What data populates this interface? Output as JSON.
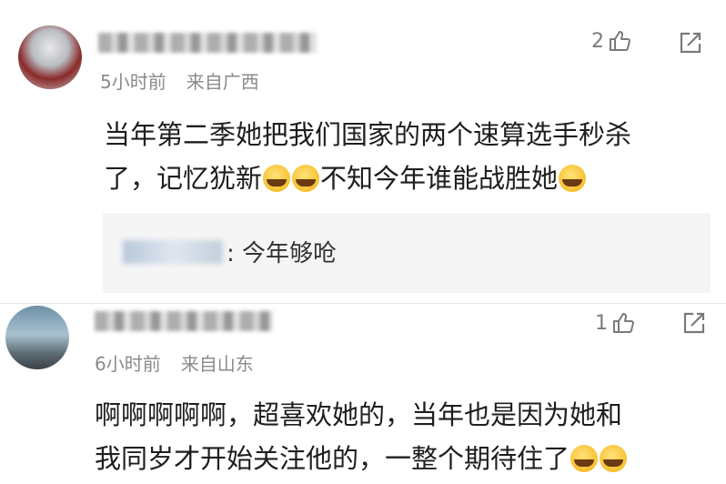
{
  "comments": [
    {
      "time": "5小时前",
      "location": "来自广西",
      "likes": "2",
      "text_line1": "当年第二季她把我们国家的两个速算选手秒杀",
      "text_line2_a": "了，记忆犹新",
      "text_line2_b": "不知今年谁能战胜她",
      "reply": {
        "text": ": 今年够呛"
      }
    },
    {
      "time": "6小时前",
      "location": "来自山东",
      "likes": "1",
      "text_line1": "啊啊啊啊啊，超喜欢她的，当年也是因为她和",
      "text_line2": "我同岁才开始关注他的，一整个期待住了"
    }
  ],
  "icons": {
    "like": "thumbs-up-outline",
    "share": "share-outline",
    "emoji_cry_laugh": "face-with-tears-of-joy",
    "emoji_excited": "face-screaming-joy"
  },
  "colors": {
    "meta": "#8a8a8a",
    "reply_bg": "#f5f5f5"
  }
}
